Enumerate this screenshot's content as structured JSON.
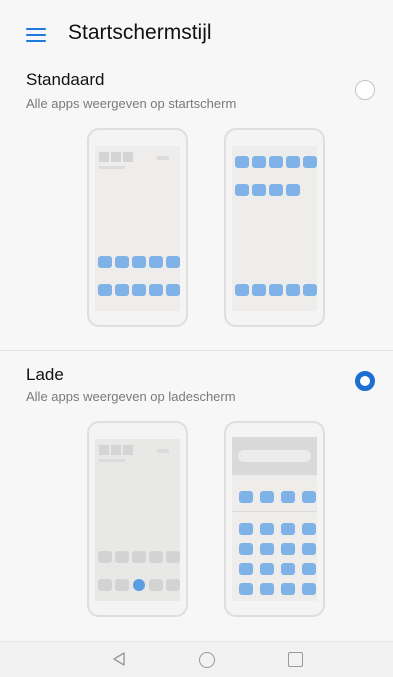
{
  "header": {
    "title": "Startschermstijl",
    "menu_icon": "hamburger-menu-icon",
    "accent": "#1f7ae0"
  },
  "options": [
    {
      "title": "Standaard",
      "subtitle": "Alle apps weergeven op startscherm",
      "selected": false
    },
    {
      "title": "Lade",
      "subtitle": "Alle apps weergeven op ladescherm",
      "selected": true
    }
  ],
  "colors": {
    "radio_selected": "#1f6fd2",
    "app_icon": "#7fb2e6",
    "preview_background": "#eeedeb"
  },
  "navbar": {
    "back_icon": "triangle-back-icon",
    "home_icon": "circle-home-icon",
    "recents_icon": "square-recents-icon"
  }
}
